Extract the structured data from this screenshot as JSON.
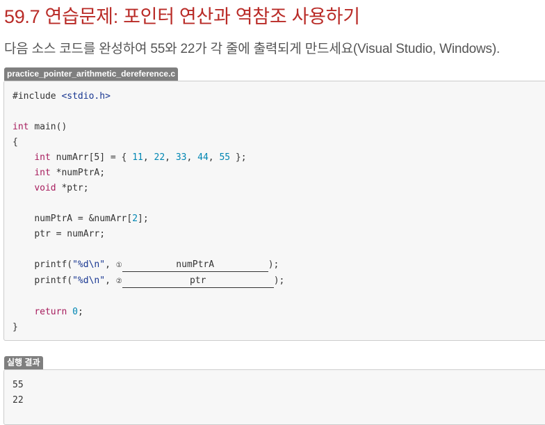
{
  "page": {
    "title": "59.7 연습문제: 포인터 연산과 역참조 사용하기",
    "description": "다음 소스 코드를 완성하여 55와 22가 각 줄에 출력되게 만드세요(Visual Studio, Windows)."
  },
  "code_block": {
    "filename": "practice_pointer_arithmetic_dereference.c",
    "include": "#include",
    "header": "<stdio.h>",
    "line_main_type": "int",
    "line_main_name": "main()",
    "open_brace": "{",
    "close_brace": "}",
    "line_arr_type": "int",
    "line_arr_decl": "numArr[5] = { ",
    "arr_values": [
      "11",
      "22",
      "33",
      "44",
      "55"
    ],
    "line_arr_end": " };",
    "line_ptra_type": "int",
    "line_ptra_decl": "*numPtrA;",
    "line_ptr_type": "void",
    "line_ptr_decl": "*ptr;",
    "assign_a": "numPtrA = &numArr[",
    "assign_a_index": "2",
    "assign_a_end": "];",
    "assign_ptr": "ptr = numArr;",
    "printf_name": "printf(",
    "format_str": "\"%d\\n\"",
    "printf_sep": ", ",
    "blank1_marker": "①",
    "blank1_text": "numPtrA",
    "blank2_marker": "②",
    "blank2_text": "ptr",
    "printf_end": ");",
    "return_kw": "return",
    "return_val": "0",
    "return_end": ";"
  },
  "result": {
    "label": "실행 결과",
    "lines": [
      "55",
      "22"
    ]
  }
}
